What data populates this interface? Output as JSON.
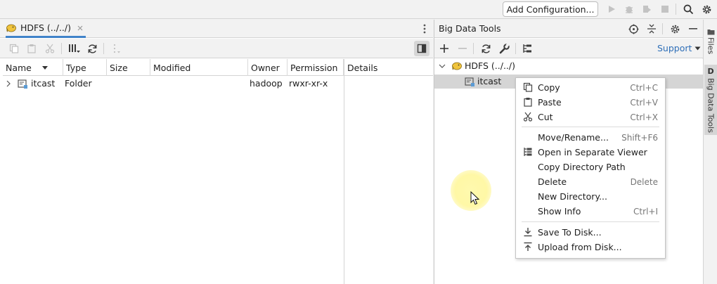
{
  "toolbar": {
    "add_config_label": "Add Configuration..."
  },
  "hdfs": {
    "tab_title": "HDFS (../../)",
    "columns": [
      "Name",
      "Type",
      "Size",
      "Modified",
      "Owner",
      "Permission",
      "Details"
    ],
    "rows": [
      {
        "name": "itcast",
        "type": "Folder",
        "size": "",
        "modified": "",
        "owner": "hadoop",
        "permission": "rwxr-xr-x"
      }
    ]
  },
  "bigdata": {
    "title": "Big Data Tools",
    "support_label": "Support",
    "tree": {
      "root": "HDFS (../../)",
      "child": "itcast"
    }
  },
  "side_tabs": {
    "files": "Files",
    "bigdata": "Big Data Tools",
    "bigdata_badge": "D"
  },
  "context_menu": {
    "items": [
      {
        "label": "Copy",
        "shortcut": "Ctrl+C",
        "icon": "copy-icon"
      },
      {
        "label": "Paste",
        "shortcut": "Ctrl+V",
        "icon": "paste-icon"
      },
      {
        "label": "Cut",
        "shortcut": "Ctrl+X",
        "icon": "scissors-icon"
      },
      {
        "label": "Move/Rename...",
        "shortcut": "Shift+F6",
        "icon": ""
      },
      {
        "label": "Open in Separate Viewer",
        "shortcut": "",
        "icon": "split-view-icon"
      },
      {
        "label": "Copy Directory Path",
        "shortcut": "",
        "icon": ""
      },
      {
        "label": "Delete",
        "shortcut": "Delete",
        "icon": ""
      },
      {
        "label": "New Directory...",
        "shortcut": "",
        "icon": ""
      },
      {
        "label": "Show Info",
        "shortcut": "Ctrl+I",
        "icon": ""
      },
      {
        "label": "Save To Disk...",
        "shortcut": "",
        "icon": "download-icon"
      },
      {
        "label": "Upload from Disk...",
        "shortcut": "",
        "icon": "upload-icon"
      }
    ]
  },
  "colors": {
    "accent_blue": "#4083c9",
    "selection_gray": "#d5d5d5",
    "icon_gray": "#6e6e6e",
    "cursor_highlight": "#fff6a0"
  }
}
